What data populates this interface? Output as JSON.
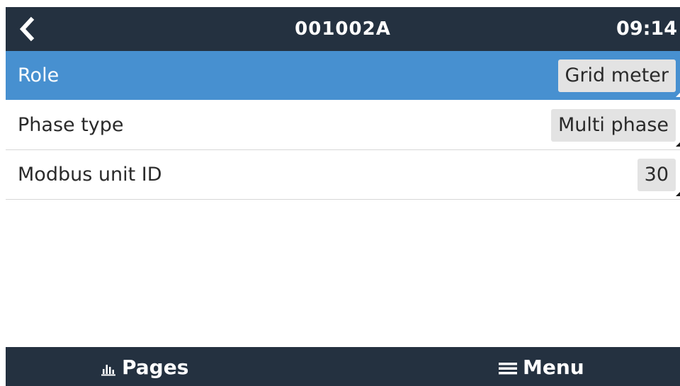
{
  "header": {
    "back_icon": "chevron-left-icon",
    "title": "001002A",
    "clock": "09:14"
  },
  "rows": [
    {
      "label": "Role",
      "value": "Grid meter",
      "selected": true
    },
    {
      "label": "Phase type",
      "value": "Multi phase",
      "selected": false
    },
    {
      "label": "Modbus unit ID",
      "value": "30",
      "selected": false
    }
  ],
  "footer": {
    "pages_label": "Pages",
    "pages_icon": "bar-chart-icon",
    "menu_label": "Menu",
    "menu_icon": "hamburger-menu-icon"
  },
  "colors": {
    "bar_background": "#243140",
    "selected_row": "#4790d0",
    "value_chip": "#e3e3e3"
  }
}
